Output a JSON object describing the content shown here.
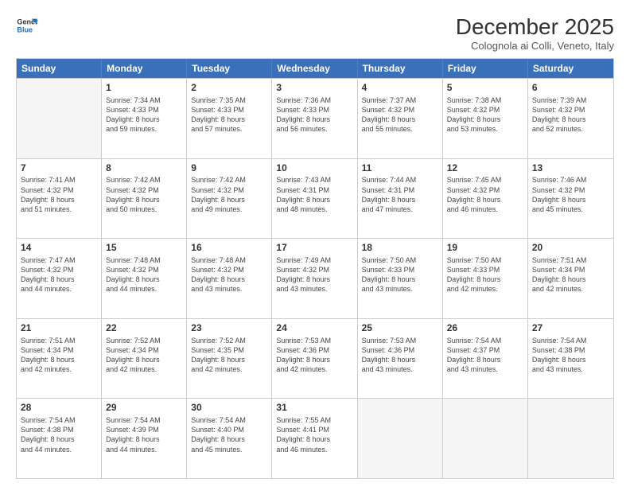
{
  "logo": {
    "line1": "General",
    "line2": "Blue"
  },
  "title": "December 2025",
  "subtitle": "Colognola ai Colli, Veneto, Italy",
  "header": {
    "days": [
      "Sunday",
      "Monday",
      "Tuesday",
      "Wednesday",
      "Thursday",
      "Friday",
      "Saturday"
    ]
  },
  "rows": [
    [
      {
        "day": "",
        "empty": true
      },
      {
        "day": "1",
        "lines": [
          "Sunrise: 7:34 AM",
          "Sunset: 4:33 PM",
          "Daylight: 8 hours",
          "and 59 minutes."
        ]
      },
      {
        "day": "2",
        "lines": [
          "Sunrise: 7:35 AM",
          "Sunset: 4:33 PM",
          "Daylight: 8 hours",
          "and 57 minutes."
        ]
      },
      {
        "day": "3",
        "lines": [
          "Sunrise: 7:36 AM",
          "Sunset: 4:33 PM",
          "Daylight: 8 hours",
          "and 56 minutes."
        ]
      },
      {
        "day": "4",
        "lines": [
          "Sunrise: 7:37 AM",
          "Sunset: 4:32 PM",
          "Daylight: 8 hours",
          "and 55 minutes."
        ]
      },
      {
        "day": "5",
        "lines": [
          "Sunrise: 7:38 AM",
          "Sunset: 4:32 PM",
          "Daylight: 8 hours",
          "and 53 minutes."
        ]
      },
      {
        "day": "6",
        "lines": [
          "Sunrise: 7:39 AM",
          "Sunset: 4:32 PM",
          "Daylight: 8 hours",
          "and 52 minutes."
        ]
      }
    ],
    [
      {
        "day": "7",
        "lines": [
          "Sunrise: 7:41 AM",
          "Sunset: 4:32 PM",
          "Daylight: 8 hours",
          "and 51 minutes."
        ]
      },
      {
        "day": "8",
        "lines": [
          "Sunrise: 7:42 AM",
          "Sunset: 4:32 PM",
          "Daylight: 8 hours",
          "and 50 minutes."
        ]
      },
      {
        "day": "9",
        "lines": [
          "Sunrise: 7:42 AM",
          "Sunset: 4:32 PM",
          "Daylight: 8 hours",
          "and 49 minutes."
        ]
      },
      {
        "day": "10",
        "lines": [
          "Sunrise: 7:43 AM",
          "Sunset: 4:31 PM",
          "Daylight: 8 hours",
          "and 48 minutes."
        ]
      },
      {
        "day": "11",
        "lines": [
          "Sunrise: 7:44 AM",
          "Sunset: 4:31 PM",
          "Daylight: 8 hours",
          "and 47 minutes."
        ]
      },
      {
        "day": "12",
        "lines": [
          "Sunrise: 7:45 AM",
          "Sunset: 4:32 PM",
          "Daylight: 8 hours",
          "and 46 minutes."
        ]
      },
      {
        "day": "13",
        "lines": [
          "Sunrise: 7:46 AM",
          "Sunset: 4:32 PM",
          "Daylight: 8 hours",
          "and 45 minutes."
        ]
      }
    ],
    [
      {
        "day": "14",
        "lines": [
          "Sunrise: 7:47 AM",
          "Sunset: 4:32 PM",
          "Daylight: 8 hours",
          "and 44 minutes."
        ]
      },
      {
        "day": "15",
        "lines": [
          "Sunrise: 7:48 AM",
          "Sunset: 4:32 PM",
          "Daylight: 8 hours",
          "and 44 minutes."
        ]
      },
      {
        "day": "16",
        "lines": [
          "Sunrise: 7:48 AM",
          "Sunset: 4:32 PM",
          "Daylight: 8 hours",
          "and 43 minutes."
        ]
      },
      {
        "day": "17",
        "lines": [
          "Sunrise: 7:49 AM",
          "Sunset: 4:32 PM",
          "Daylight: 8 hours",
          "and 43 minutes."
        ]
      },
      {
        "day": "18",
        "lines": [
          "Sunrise: 7:50 AM",
          "Sunset: 4:33 PM",
          "Daylight: 8 hours",
          "and 43 minutes."
        ]
      },
      {
        "day": "19",
        "lines": [
          "Sunrise: 7:50 AM",
          "Sunset: 4:33 PM",
          "Daylight: 8 hours",
          "and 42 minutes."
        ]
      },
      {
        "day": "20",
        "lines": [
          "Sunrise: 7:51 AM",
          "Sunset: 4:34 PM",
          "Daylight: 8 hours",
          "and 42 minutes."
        ]
      }
    ],
    [
      {
        "day": "21",
        "lines": [
          "Sunrise: 7:51 AM",
          "Sunset: 4:34 PM",
          "Daylight: 8 hours",
          "and 42 minutes."
        ]
      },
      {
        "day": "22",
        "lines": [
          "Sunrise: 7:52 AM",
          "Sunset: 4:34 PM",
          "Daylight: 8 hours",
          "and 42 minutes."
        ]
      },
      {
        "day": "23",
        "lines": [
          "Sunrise: 7:52 AM",
          "Sunset: 4:35 PM",
          "Daylight: 8 hours",
          "and 42 minutes."
        ]
      },
      {
        "day": "24",
        "lines": [
          "Sunrise: 7:53 AM",
          "Sunset: 4:36 PM",
          "Daylight: 8 hours",
          "and 42 minutes."
        ]
      },
      {
        "day": "25",
        "lines": [
          "Sunrise: 7:53 AM",
          "Sunset: 4:36 PM",
          "Daylight: 8 hours",
          "and 43 minutes."
        ]
      },
      {
        "day": "26",
        "lines": [
          "Sunrise: 7:54 AM",
          "Sunset: 4:37 PM",
          "Daylight: 8 hours",
          "and 43 minutes."
        ]
      },
      {
        "day": "27",
        "lines": [
          "Sunrise: 7:54 AM",
          "Sunset: 4:38 PM",
          "Daylight: 8 hours",
          "and 43 minutes."
        ]
      }
    ],
    [
      {
        "day": "28",
        "lines": [
          "Sunrise: 7:54 AM",
          "Sunset: 4:38 PM",
          "Daylight: 8 hours",
          "and 44 minutes."
        ]
      },
      {
        "day": "29",
        "lines": [
          "Sunrise: 7:54 AM",
          "Sunset: 4:39 PM",
          "Daylight: 8 hours",
          "and 44 minutes."
        ]
      },
      {
        "day": "30",
        "lines": [
          "Sunrise: 7:54 AM",
          "Sunset: 4:40 PM",
          "Daylight: 8 hours",
          "and 45 minutes."
        ]
      },
      {
        "day": "31",
        "lines": [
          "Sunrise: 7:55 AM",
          "Sunset: 4:41 PM",
          "Daylight: 8 hours",
          "and 46 minutes."
        ]
      },
      {
        "day": "",
        "empty": true
      },
      {
        "day": "",
        "empty": true
      },
      {
        "day": "",
        "empty": true
      }
    ]
  ]
}
